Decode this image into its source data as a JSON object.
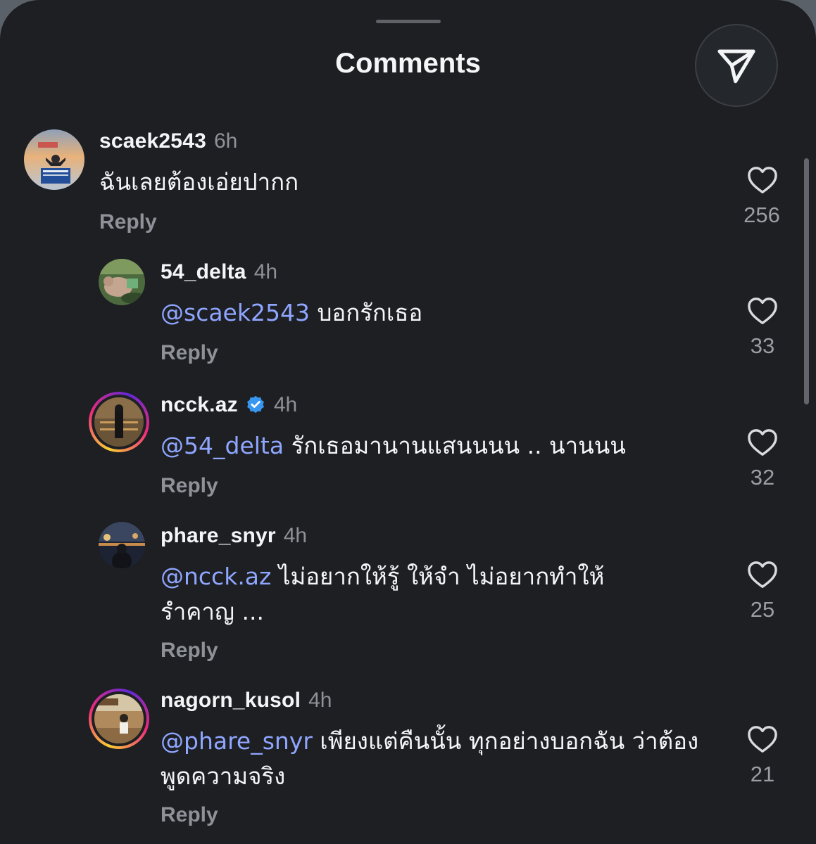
{
  "header": {
    "title": "Comments",
    "share_icon": "paper-plane-icon"
  },
  "comments": [
    {
      "username": "scaek2543",
      "time": "6h",
      "mention": "",
      "text": "ฉันเลยต้องเอ่ยปากก",
      "reply_label": "Reply",
      "likes": "256",
      "verified": false
    },
    {
      "username": "54_delta",
      "time": "4h",
      "mention": "@scaek2543",
      "text": " บอกรักเธอ",
      "reply_label": "Reply",
      "likes": "33",
      "verified": false
    },
    {
      "username": "ncck.az",
      "time": "4h",
      "mention": "@54_delta",
      "text": " รักเธอมานานแสนนนน .. นานนน",
      "reply_label": "Reply",
      "likes": "32",
      "verified": true
    },
    {
      "username": "phare_snyr",
      "time": "4h",
      "mention": "@ncck.az",
      "text": " ไม่อยากให้รู้ ให้จำ ไม่อยากทำให้รำคาญ ...",
      "reply_label": "Reply",
      "likes": "25",
      "verified": false
    },
    {
      "username": "nagorn_kusol",
      "time": "4h",
      "mention": "@phare_snyr",
      "text": " เพียงแต่คืนนั้น ทุกอย่างบอกฉัน ว่าต้องพูดความจริง",
      "reply_label": "Reply",
      "likes": "21",
      "verified": false
    }
  ],
  "colors": {
    "background": "#1d1f23",
    "mention": "#8fa6ff",
    "muted": "#8e9197",
    "verified": "#3797f0"
  }
}
